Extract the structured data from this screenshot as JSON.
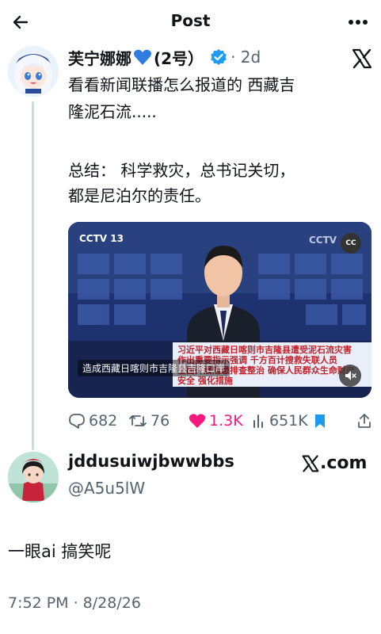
{
  "topbar": {
    "title": "Post"
  },
  "post": {
    "display_name": "芙宁娜娜",
    "display_name_suffix": "(2号）",
    "time": "· 2d",
    "text_lines": [
      "看看新闻联播怎么报道的 西藏吉",
      "隆泥石流.....",
      "总结： 科学救灾，总书记关切，",
      "都是尼泊尔的责任。"
    ],
    "media": {
      "channel": "CCTV 13",
      "channel2": "CCTV",
      "cc_label": "CC",
      "caption": "造成西藏日喀则市吉隆县吉隆口岸",
      "headline_lines": [
        "习近平对西藏日喀则市吉隆县遭受泥石流灾害",
        "作出重要指示强调 千方百计搜救失联人员",
        "全面开展隐患排查整治 确保人民群众生命财产",
        "安全 强化措施"
      ]
    },
    "stats": {
      "replies": "682",
      "reposts": "76",
      "likes": "1.3K",
      "views": "651K"
    }
  },
  "reply": {
    "display_name": "jddusuiwjbwwbbs",
    "handle": "@A5u5lW",
    "badge_text": ".com",
    "text": "一眼ai 搞笑呢",
    "timestamp": "7:52 PM · 8/28/26"
  },
  "colors": {
    "verified": "#1d9bf0",
    "like": "#f91880",
    "heart_emoji": "#2f7de1",
    "muted": "#536471"
  }
}
